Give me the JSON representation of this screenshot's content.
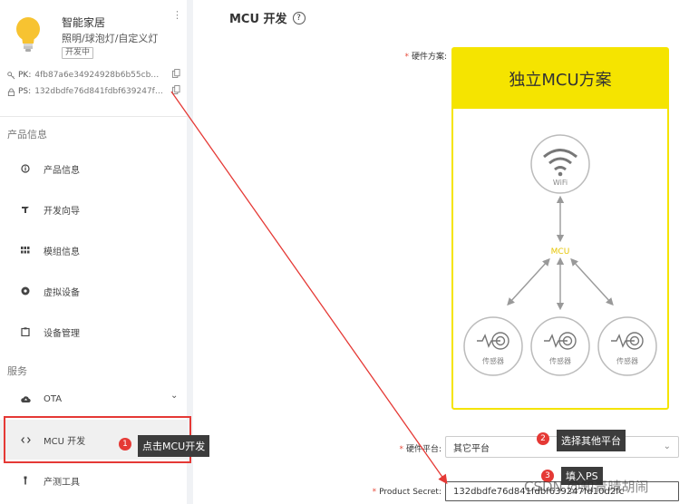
{
  "product": {
    "name": "智能家居",
    "category": "照明/球泡灯/自定义灯",
    "status_badge": "开发中",
    "pk_label": "PK:",
    "pk_value": "4fb87a6e34924928b6b55cb05eb...",
    "ps_label": "PS:",
    "ps_value": "132dbdfe76d841fdbf639247fd10..."
  },
  "sidebar": {
    "section_product": "产品信息",
    "section_service": "服务",
    "items": [
      {
        "label": "产品信息",
        "icon": "info-icon"
      },
      {
        "label": "开发向导",
        "icon": "guide-icon"
      },
      {
        "label": "模组信息",
        "icon": "grid-icon"
      },
      {
        "label": "虚拟设备",
        "icon": "virtual-device-icon"
      },
      {
        "label": "设备管理",
        "icon": "clipboard-icon"
      },
      {
        "label": "OTA",
        "icon": "cloud-upload-icon"
      },
      {
        "label": "MCU 开发",
        "icon": "code-icon"
      },
      {
        "label": "产测工具",
        "icon": "tool-icon"
      }
    ]
  },
  "main": {
    "title": "MCU 开发",
    "hardware_scheme_label": "硬件方案:",
    "scheme_card_title": "独立MCU方案",
    "wifi_label": "WiFi",
    "mcu_label": "MCU",
    "sensor_label": "传感器",
    "hardware_platform_label": "硬件平台:",
    "hardware_platform_value": "其它平台",
    "product_secret_label": "Product Secret:",
    "product_secret_value": "132dbdfe76d841fdbf639247fd10d2fc"
  },
  "annotations": {
    "step1_num": "1",
    "step1_text": "点击MCU开发",
    "step2_num": "2",
    "step2_text": "选择其他平台",
    "step3_num": "3",
    "step3_text": "填入PS",
    "watermark": "CSDN @知青晴胡闹"
  },
  "colors": {
    "accent_yellow": "#f5e400",
    "annotation_red": "#e53935",
    "active_bg": "#f0f0f0"
  }
}
